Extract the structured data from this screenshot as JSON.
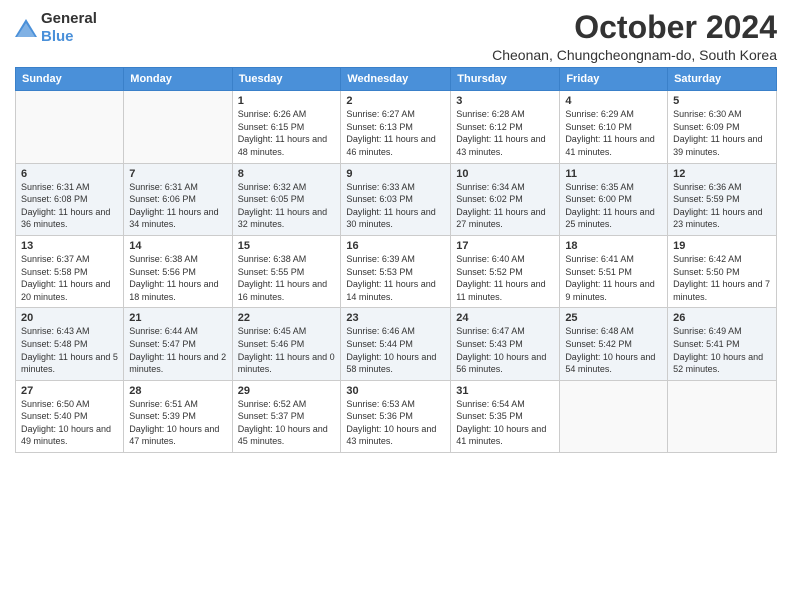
{
  "logo": {
    "text_general": "General",
    "text_blue": "Blue"
  },
  "title": "October 2024",
  "subtitle": "Cheonan, Chungcheongnam-do, South Korea",
  "days_of_week": [
    "Sunday",
    "Monday",
    "Tuesday",
    "Wednesday",
    "Thursday",
    "Friday",
    "Saturday"
  ],
  "weeks": [
    [
      {
        "day": "",
        "sunrise": "",
        "sunset": "",
        "daylight": ""
      },
      {
        "day": "",
        "sunrise": "",
        "sunset": "",
        "daylight": ""
      },
      {
        "day": "1",
        "sunrise": "Sunrise: 6:26 AM",
        "sunset": "Sunset: 6:15 PM",
        "daylight": "Daylight: 11 hours and 48 minutes."
      },
      {
        "day": "2",
        "sunrise": "Sunrise: 6:27 AM",
        "sunset": "Sunset: 6:13 PM",
        "daylight": "Daylight: 11 hours and 46 minutes."
      },
      {
        "day": "3",
        "sunrise": "Sunrise: 6:28 AM",
        "sunset": "Sunset: 6:12 PM",
        "daylight": "Daylight: 11 hours and 43 minutes."
      },
      {
        "day": "4",
        "sunrise": "Sunrise: 6:29 AM",
        "sunset": "Sunset: 6:10 PM",
        "daylight": "Daylight: 11 hours and 41 minutes."
      },
      {
        "day": "5",
        "sunrise": "Sunrise: 6:30 AM",
        "sunset": "Sunset: 6:09 PM",
        "daylight": "Daylight: 11 hours and 39 minutes."
      }
    ],
    [
      {
        "day": "6",
        "sunrise": "Sunrise: 6:31 AM",
        "sunset": "Sunset: 6:08 PM",
        "daylight": "Daylight: 11 hours and 36 minutes."
      },
      {
        "day": "7",
        "sunrise": "Sunrise: 6:31 AM",
        "sunset": "Sunset: 6:06 PM",
        "daylight": "Daylight: 11 hours and 34 minutes."
      },
      {
        "day": "8",
        "sunrise": "Sunrise: 6:32 AM",
        "sunset": "Sunset: 6:05 PM",
        "daylight": "Daylight: 11 hours and 32 minutes."
      },
      {
        "day": "9",
        "sunrise": "Sunrise: 6:33 AM",
        "sunset": "Sunset: 6:03 PM",
        "daylight": "Daylight: 11 hours and 30 minutes."
      },
      {
        "day": "10",
        "sunrise": "Sunrise: 6:34 AM",
        "sunset": "Sunset: 6:02 PM",
        "daylight": "Daylight: 11 hours and 27 minutes."
      },
      {
        "day": "11",
        "sunrise": "Sunrise: 6:35 AM",
        "sunset": "Sunset: 6:00 PM",
        "daylight": "Daylight: 11 hours and 25 minutes."
      },
      {
        "day": "12",
        "sunrise": "Sunrise: 6:36 AM",
        "sunset": "Sunset: 5:59 PM",
        "daylight": "Daylight: 11 hours and 23 minutes."
      }
    ],
    [
      {
        "day": "13",
        "sunrise": "Sunrise: 6:37 AM",
        "sunset": "Sunset: 5:58 PM",
        "daylight": "Daylight: 11 hours and 20 minutes."
      },
      {
        "day": "14",
        "sunrise": "Sunrise: 6:38 AM",
        "sunset": "Sunset: 5:56 PM",
        "daylight": "Daylight: 11 hours and 18 minutes."
      },
      {
        "day": "15",
        "sunrise": "Sunrise: 6:38 AM",
        "sunset": "Sunset: 5:55 PM",
        "daylight": "Daylight: 11 hours and 16 minutes."
      },
      {
        "day": "16",
        "sunrise": "Sunrise: 6:39 AM",
        "sunset": "Sunset: 5:53 PM",
        "daylight": "Daylight: 11 hours and 14 minutes."
      },
      {
        "day": "17",
        "sunrise": "Sunrise: 6:40 AM",
        "sunset": "Sunset: 5:52 PM",
        "daylight": "Daylight: 11 hours and 11 minutes."
      },
      {
        "day": "18",
        "sunrise": "Sunrise: 6:41 AM",
        "sunset": "Sunset: 5:51 PM",
        "daylight": "Daylight: 11 hours and 9 minutes."
      },
      {
        "day": "19",
        "sunrise": "Sunrise: 6:42 AM",
        "sunset": "Sunset: 5:50 PM",
        "daylight": "Daylight: 11 hours and 7 minutes."
      }
    ],
    [
      {
        "day": "20",
        "sunrise": "Sunrise: 6:43 AM",
        "sunset": "Sunset: 5:48 PM",
        "daylight": "Daylight: 11 hours and 5 minutes."
      },
      {
        "day": "21",
        "sunrise": "Sunrise: 6:44 AM",
        "sunset": "Sunset: 5:47 PM",
        "daylight": "Daylight: 11 hours and 2 minutes."
      },
      {
        "day": "22",
        "sunrise": "Sunrise: 6:45 AM",
        "sunset": "Sunset: 5:46 PM",
        "daylight": "Daylight: 11 hours and 0 minutes."
      },
      {
        "day": "23",
        "sunrise": "Sunrise: 6:46 AM",
        "sunset": "Sunset: 5:44 PM",
        "daylight": "Daylight: 10 hours and 58 minutes."
      },
      {
        "day": "24",
        "sunrise": "Sunrise: 6:47 AM",
        "sunset": "Sunset: 5:43 PM",
        "daylight": "Daylight: 10 hours and 56 minutes."
      },
      {
        "day": "25",
        "sunrise": "Sunrise: 6:48 AM",
        "sunset": "Sunset: 5:42 PM",
        "daylight": "Daylight: 10 hours and 54 minutes."
      },
      {
        "day": "26",
        "sunrise": "Sunrise: 6:49 AM",
        "sunset": "Sunset: 5:41 PM",
        "daylight": "Daylight: 10 hours and 52 minutes."
      }
    ],
    [
      {
        "day": "27",
        "sunrise": "Sunrise: 6:50 AM",
        "sunset": "Sunset: 5:40 PM",
        "daylight": "Daylight: 10 hours and 49 minutes."
      },
      {
        "day": "28",
        "sunrise": "Sunrise: 6:51 AM",
        "sunset": "Sunset: 5:39 PM",
        "daylight": "Daylight: 10 hours and 47 minutes."
      },
      {
        "day": "29",
        "sunrise": "Sunrise: 6:52 AM",
        "sunset": "Sunset: 5:37 PM",
        "daylight": "Daylight: 10 hours and 45 minutes."
      },
      {
        "day": "30",
        "sunrise": "Sunrise: 6:53 AM",
        "sunset": "Sunset: 5:36 PM",
        "daylight": "Daylight: 10 hours and 43 minutes."
      },
      {
        "day": "31",
        "sunrise": "Sunrise: 6:54 AM",
        "sunset": "Sunset: 5:35 PM",
        "daylight": "Daylight: 10 hours and 41 minutes."
      },
      {
        "day": "",
        "sunrise": "",
        "sunset": "",
        "daylight": ""
      },
      {
        "day": "",
        "sunrise": "",
        "sunset": "",
        "daylight": ""
      }
    ]
  ]
}
